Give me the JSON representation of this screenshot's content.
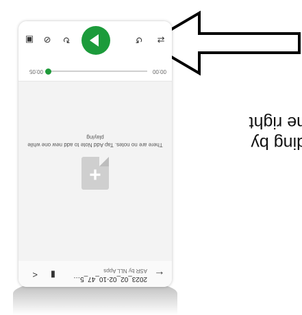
{
  "caption": {
    "lines": [
      "ding by",
      "ne right"
    ]
  },
  "app": {
    "title": "2023_02_02-10_47_5…",
    "subtitle": "ASR by NLL Apps",
    "icons": {
      "back": "arrow-back-icon",
      "phone": "phone-icon",
      "share": "share-icon"
    }
  },
  "empty_state": {
    "icon": "add-note-icon",
    "message": "There are no notes. Tap Add Note to add new one while playing"
  },
  "player": {
    "elapsed": "00:00",
    "duration": "00:05",
    "progress": 0,
    "controls": {
      "repeat": "repeat-icon",
      "rewind": "rewind-icon",
      "play": "play-icon",
      "forward": "forward-icon",
      "speed": "speed-icon",
      "note": "note-icon"
    },
    "accent_color": "#1c9b3b"
  }
}
